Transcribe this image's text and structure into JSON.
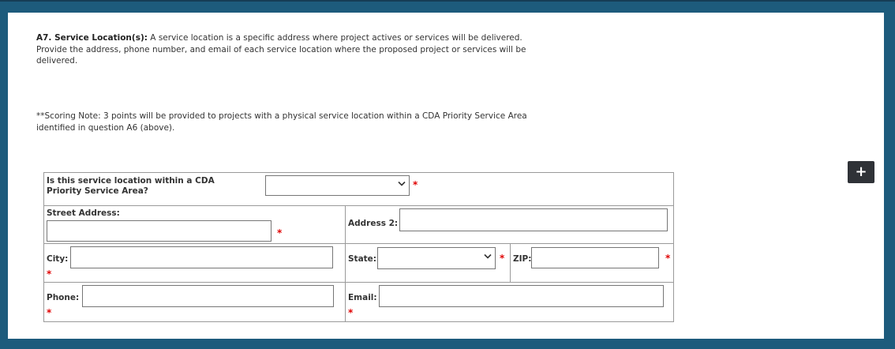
{
  "section": {
    "title_label": "A7. Service Location(s):",
    "description": "A service location is a specific address where project actives or services will be delivered. Provide the address, phone number, and email of each service location where the proposed project or services will be delivered.",
    "scoring_note": "**Scoring Note: 3 points will be provided to projects with a physical service location within a CDA Priority Service Area identified in question A6 (above)."
  },
  "add_button": {
    "label": "+",
    "icon": "plus-icon"
  },
  "form": {
    "priority_question": "Is this service location within a CDA Priority Service Area?",
    "priority_value": "",
    "street_label": "Street Address:",
    "street_value": "",
    "address2_label": "Address 2:",
    "address2_value": "",
    "city_label": "City:",
    "city_value": "",
    "state_label": "State:",
    "state_value": "",
    "zip_label": "ZIP:",
    "zip_value": "",
    "phone_label": "Phone:",
    "phone_value": "",
    "email_label": "Email:",
    "email_value": "",
    "required_marker": "*"
  },
  "colors": {
    "frame": "#1d5b7c",
    "panel": "#ffffff",
    "required": "#e00000",
    "button": "#2f3237"
  }
}
